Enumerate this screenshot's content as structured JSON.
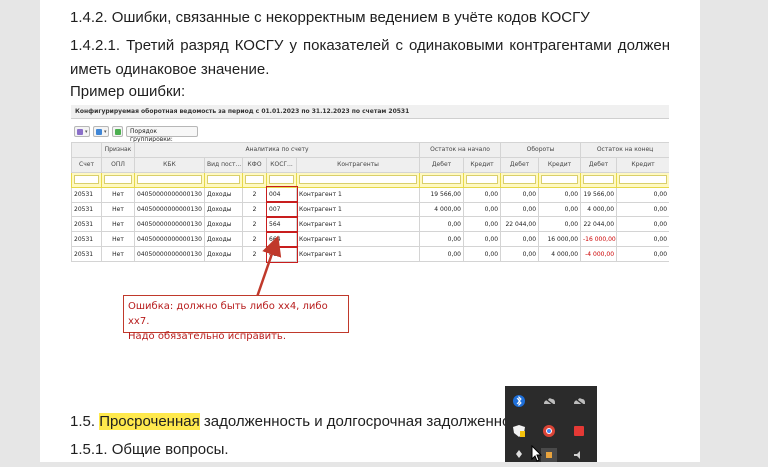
{
  "doc": {
    "h_142": "1.4.2. Ошибки, связанные с некорректным ведением в учёте кодов КОСГУ",
    "h_1421": "1.4.2.1. Третий разряд КОСГУ у показателей с одинаковыми контрагентами должен иметь одинаковое значение.",
    "example": "Пример ошибки:",
    "h_15_pre": "1.5. ",
    "h_15_hl": "Просроченная",
    "h_15_post": " задолженность и долгосрочная задолженность",
    "h_151": "1.5.1. Общие вопросы."
  },
  "report": {
    "title": "Конфигурируемая оборотная ведомость за период с 01.01.2023 по 31.12.2023 по счетам 20531",
    "grouping_label": "Порядок группировки:",
    "group_headers": [
      "Признак",
      "Аналитика по счету",
      "Остаток на начало",
      "Обороты",
      "Остаток на конец"
    ],
    "columns": [
      "Счет",
      "ОПЛ",
      "КБК",
      "Вид пост...",
      "КФО",
      "КОСГ...",
      "Контрагенты",
      "Дебет",
      "Кредит",
      "Дебет",
      "Кредит",
      "Дебет",
      "Кредит"
    ],
    "rows": [
      [
        "20531",
        "Нет",
        "04050000000000130",
        "Доходы",
        "2",
        "004",
        "Контрагент 1",
        "19 566,00",
        "0,00",
        "0,00",
        "0,00",
        "19 566,00",
        "0,00"
      ],
      [
        "20531",
        "Нет",
        "04050000000000130",
        "Доходы",
        "2",
        "007",
        "Контрагент 1",
        "4 000,00",
        "0,00",
        "0,00",
        "0,00",
        "4 000,00",
        "0,00"
      ],
      [
        "20531",
        "Нет",
        "04050000000000130",
        "Доходы",
        "2",
        "564",
        "Контрагент 1",
        "0,00",
        "0,00",
        "22 044,00",
        "0,00",
        "22 044,00",
        "0,00"
      ],
      [
        "20531",
        "Нет",
        "04050000000000130",
        "Доходы",
        "2",
        "664",
        "Контрагент 1",
        "0,00",
        "0,00",
        "0,00",
        "16 000,00",
        "-16 000,00",
        "0,00"
      ],
      [
        "20531",
        "Нет",
        "04050000000000130",
        "Доходы",
        "2",
        "667",
        "Контрагент 1",
        "0,00",
        "0,00",
        "0,00",
        "4 000,00",
        "-4 000,00",
        "0,00"
      ]
    ],
    "error_line1": "Ошибка: должно быть либо хх4, либо хх7.",
    "error_line2": "Надо обязательно исправить."
  },
  "tray_icons": [
    "bluetooth-icon",
    "cloud-icon",
    "cloud-icon",
    "shield-icon",
    "chrome-icon",
    "app-icon",
    "usb-icon",
    "network-icon",
    "volume-icon"
  ],
  "colors": {
    "highlight": "#ffe94d",
    "error": "#c0392b",
    "negative": "#cc0000"
  }
}
